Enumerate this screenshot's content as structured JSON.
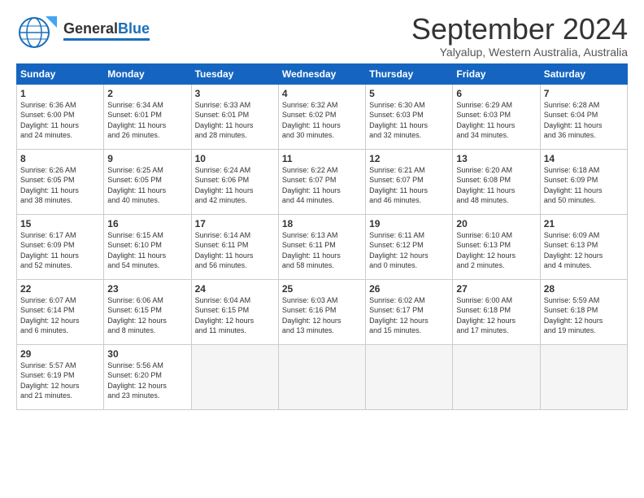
{
  "header": {
    "logo_line1": "General",
    "logo_line2": "Blue",
    "month_title": "September 2024",
    "location": "Yalyalup, Western Australia, Australia"
  },
  "calendar": {
    "days_of_week": [
      "Sunday",
      "Monday",
      "Tuesday",
      "Wednesday",
      "Thursday",
      "Friday",
      "Saturday"
    ],
    "weeks": [
      [
        {
          "day": 1,
          "info": "Sunrise: 6:36 AM\nSunset: 6:00 PM\nDaylight: 11 hours\nand 24 minutes."
        },
        {
          "day": 2,
          "info": "Sunrise: 6:34 AM\nSunset: 6:01 PM\nDaylight: 11 hours\nand 26 minutes."
        },
        {
          "day": 3,
          "info": "Sunrise: 6:33 AM\nSunset: 6:01 PM\nDaylight: 11 hours\nand 28 minutes."
        },
        {
          "day": 4,
          "info": "Sunrise: 6:32 AM\nSunset: 6:02 PM\nDaylight: 11 hours\nand 30 minutes."
        },
        {
          "day": 5,
          "info": "Sunrise: 6:30 AM\nSunset: 6:03 PM\nDaylight: 11 hours\nand 32 minutes."
        },
        {
          "day": 6,
          "info": "Sunrise: 6:29 AM\nSunset: 6:03 PM\nDaylight: 11 hours\nand 34 minutes."
        },
        {
          "day": 7,
          "info": "Sunrise: 6:28 AM\nSunset: 6:04 PM\nDaylight: 11 hours\nand 36 minutes."
        }
      ],
      [
        {
          "day": 8,
          "info": "Sunrise: 6:26 AM\nSunset: 6:05 PM\nDaylight: 11 hours\nand 38 minutes."
        },
        {
          "day": 9,
          "info": "Sunrise: 6:25 AM\nSunset: 6:05 PM\nDaylight: 11 hours\nand 40 minutes."
        },
        {
          "day": 10,
          "info": "Sunrise: 6:24 AM\nSunset: 6:06 PM\nDaylight: 11 hours\nand 42 minutes."
        },
        {
          "day": 11,
          "info": "Sunrise: 6:22 AM\nSunset: 6:07 PM\nDaylight: 11 hours\nand 44 minutes."
        },
        {
          "day": 12,
          "info": "Sunrise: 6:21 AM\nSunset: 6:07 PM\nDaylight: 11 hours\nand 46 minutes."
        },
        {
          "day": 13,
          "info": "Sunrise: 6:20 AM\nSunset: 6:08 PM\nDaylight: 11 hours\nand 48 minutes."
        },
        {
          "day": 14,
          "info": "Sunrise: 6:18 AM\nSunset: 6:09 PM\nDaylight: 11 hours\nand 50 minutes."
        }
      ],
      [
        {
          "day": 15,
          "info": "Sunrise: 6:17 AM\nSunset: 6:09 PM\nDaylight: 11 hours\nand 52 minutes."
        },
        {
          "day": 16,
          "info": "Sunrise: 6:15 AM\nSunset: 6:10 PM\nDaylight: 11 hours\nand 54 minutes."
        },
        {
          "day": 17,
          "info": "Sunrise: 6:14 AM\nSunset: 6:11 PM\nDaylight: 11 hours\nand 56 minutes."
        },
        {
          "day": 18,
          "info": "Sunrise: 6:13 AM\nSunset: 6:11 PM\nDaylight: 11 hours\nand 58 minutes."
        },
        {
          "day": 19,
          "info": "Sunrise: 6:11 AM\nSunset: 6:12 PM\nDaylight: 12 hours\nand 0 minutes."
        },
        {
          "day": 20,
          "info": "Sunrise: 6:10 AM\nSunset: 6:13 PM\nDaylight: 12 hours\nand 2 minutes."
        },
        {
          "day": 21,
          "info": "Sunrise: 6:09 AM\nSunset: 6:13 PM\nDaylight: 12 hours\nand 4 minutes."
        }
      ],
      [
        {
          "day": 22,
          "info": "Sunrise: 6:07 AM\nSunset: 6:14 PM\nDaylight: 12 hours\nand 6 minutes."
        },
        {
          "day": 23,
          "info": "Sunrise: 6:06 AM\nSunset: 6:15 PM\nDaylight: 12 hours\nand 8 minutes."
        },
        {
          "day": 24,
          "info": "Sunrise: 6:04 AM\nSunset: 6:15 PM\nDaylight: 12 hours\nand 11 minutes."
        },
        {
          "day": 25,
          "info": "Sunrise: 6:03 AM\nSunset: 6:16 PM\nDaylight: 12 hours\nand 13 minutes."
        },
        {
          "day": 26,
          "info": "Sunrise: 6:02 AM\nSunset: 6:17 PM\nDaylight: 12 hours\nand 15 minutes."
        },
        {
          "day": 27,
          "info": "Sunrise: 6:00 AM\nSunset: 6:18 PM\nDaylight: 12 hours\nand 17 minutes."
        },
        {
          "day": 28,
          "info": "Sunrise: 5:59 AM\nSunset: 6:18 PM\nDaylight: 12 hours\nand 19 minutes."
        }
      ],
      [
        {
          "day": 29,
          "info": "Sunrise: 5:57 AM\nSunset: 6:19 PM\nDaylight: 12 hours\nand 21 minutes."
        },
        {
          "day": 30,
          "info": "Sunrise: 5:56 AM\nSunset: 6:20 PM\nDaylight: 12 hours\nand 23 minutes."
        },
        {
          "day": null,
          "info": ""
        },
        {
          "day": null,
          "info": ""
        },
        {
          "day": null,
          "info": ""
        },
        {
          "day": null,
          "info": ""
        },
        {
          "day": null,
          "info": ""
        }
      ]
    ]
  }
}
